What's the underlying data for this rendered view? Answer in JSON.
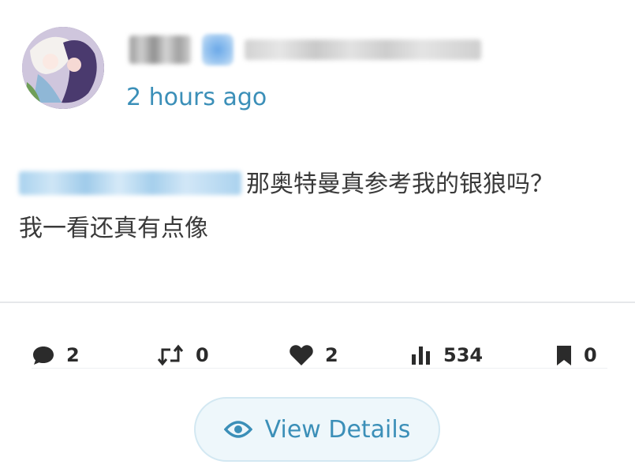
{
  "post": {
    "time": "2 hours ago",
    "content_line1": "那奥特曼真参考我的银狼吗？",
    "content_line2": "我一看还真有点像"
  },
  "actions": {
    "comments": "2",
    "reposts": "0",
    "likes": "2",
    "views": "534",
    "bookmarks": "0"
  },
  "view_details": {
    "label": "View Details"
  },
  "icons": {
    "comment": "comment-icon",
    "repost": "repost-icon",
    "like": "heart-icon",
    "views": "bar-chart-icon",
    "bookmark": "bookmark-icon",
    "view_details": "eye-icon",
    "verified": "verified-badge-icon"
  },
  "colors": {
    "accent": "#3b8fb8",
    "text": "#3a3a3a",
    "button_bg": "#eef7fb"
  }
}
